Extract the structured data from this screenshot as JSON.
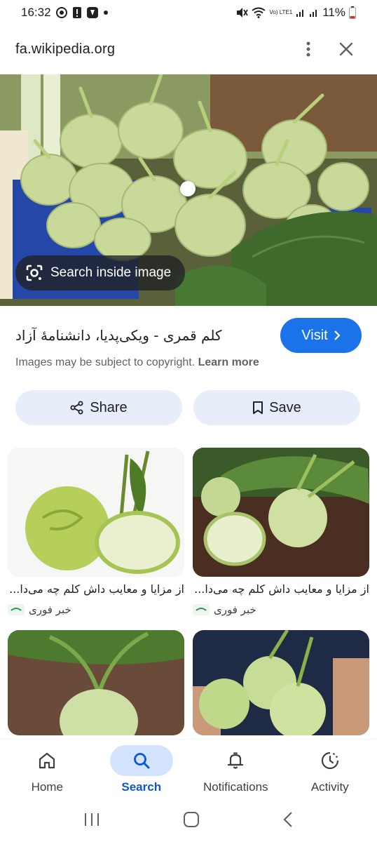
{
  "status_bar": {
    "time": "16:32",
    "battery": "11%",
    "network": "Vo) LTE1"
  },
  "browser": {
    "url": "fa.wikipedia.org"
  },
  "hero": {
    "search_inside_label": "Search inside image"
  },
  "result": {
    "title": "کلم قمری - ویکی‌پدیا، دانشنامهٔ آزاد",
    "visit_label": "Visit",
    "copyright_text": "Images may be subject to copyright.",
    "learn_more": "Learn more"
  },
  "actions": {
    "share_label": "Share",
    "save_label": "Save"
  },
  "related": [
    {
      "title": "از مزایا و معایب داش کلم چه می‌دا...",
      "source": "خبر فوری"
    },
    {
      "title": "از مزایا و معایب داش کلم چه می‌دا...",
      "source": "خبر فوری"
    },
    {
      "title": "",
      "source": ""
    },
    {
      "title": "",
      "source": ""
    }
  ],
  "bottom_nav": {
    "home": "Home",
    "search": "Search",
    "notifications": "Notifications",
    "activity": "Activity"
  },
  "colors": {
    "accent": "#1a73e8",
    "pill_bg": "#e8eef9",
    "active_nav_bg": "#d3e3fd"
  }
}
